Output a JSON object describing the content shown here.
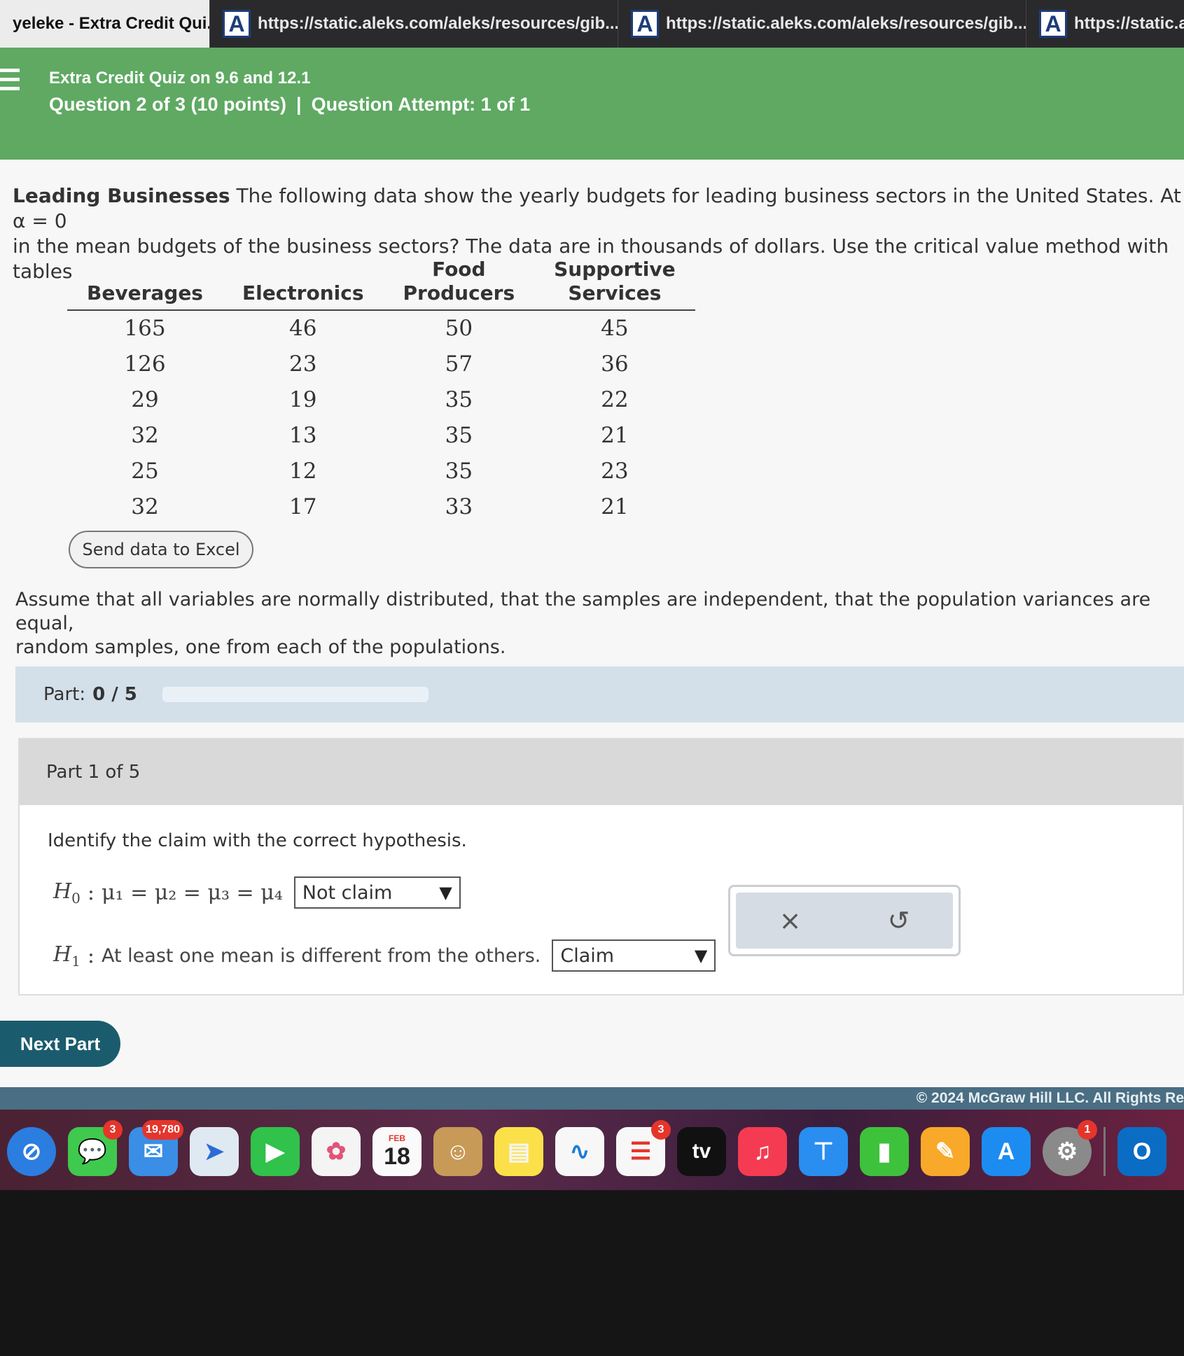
{
  "browser": {
    "tabs": [
      {
        "label": "yeleke - Extra Credit Qui..."
      },
      {
        "label": "https://static.aleks.com/aleks/resources/gib..."
      },
      {
        "label": "https://static.aleks.com/aleks/resources/gib..."
      },
      {
        "label": "https://static.a"
      }
    ],
    "favicon_letter": "A"
  },
  "header": {
    "quiz_title": "Extra Credit Quiz on 9.6 and 12.1",
    "question": "Question 2 of 3 (10 points)",
    "separator": "|",
    "attempt": "Question Attempt: 1 of 1",
    "bg_color": "#5fa963"
  },
  "problem": {
    "title": "Leading Businesses",
    "text_line1": "The following data show the yearly budgets for leading business sectors in the United States. At α = 0",
    "text_line2": "in the mean budgets of the business sectors? The data are in thousands of dollars. Use the critical value method with tables"
  },
  "table": {
    "headers": [
      {
        "line1": "Beverages",
        "line2": ""
      },
      {
        "line1": "Electronics",
        "line2": ""
      },
      {
        "line1": "Food",
        "line2": "Producers"
      },
      {
        "line1": "Supportive",
        "line2": "Services"
      }
    ],
    "rows": [
      [
        "165",
        "46",
        "50",
        "45"
      ],
      [
        "126",
        "23",
        "57",
        "36"
      ],
      [
        "29",
        "19",
        "35",
        "22"
      ],
      [
        "32",
        "13",
        "35",
        "21"
      ],
      [
        "25",
        "12",
        "35",
        "23"
      ],
      [
        "32",
        "17",
        "33",
        "21"
      ]
    ]
  },
  "send_excel_label": "Send data to Excel",
  "assumption": {
    "line1": "Assume that all variables are normally distributed, that the samples are independent, that the population variances are equal,",
    "line2": "random samples, one from each of the populations."
  },
  "part_progress": {
    "label": "Part:",
    "score": "0 / 5",
    "fraction": 0
  },
  "part": {
    "heading": "Part 1 of 5",
    "instruction": "Identify the claim with the correct hypothesis.",
    "h0_symbol": "H",
    "h0_sub": "0",
    "h0_expr": "μ₁ = μ₂ = μ₃ = μ₄",
    "h0_selected": "Not claim",
    "h1_symbol": "H",
    "h1_sub": "1",
    "h1_text": "At least one mean is different from the others.",
    "h1_selected": "Claim"
  },
  "actions": {
    "clear_icon": "×",
    "undo_icon": "↺"
  },
  "next_part_label": "Next Part",
  "footer": "© 2024 McGraw Hill LLC. All Rights Re",
  "dock": {
    "calendar_month": "FEB",
    "calendar_day": "18",
    "tv_label": "tv",
    "badges": {
      "messages": "3",
      "mail": "19,780",
      "reminders": "3",
      "settings": "1"
    }
  }
}
